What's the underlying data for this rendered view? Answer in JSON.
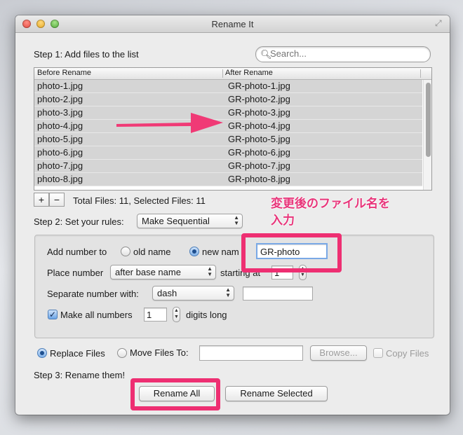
{
  "window": {
    "title": "Rename It"
  },
  "step1": {
    "label": "Step 1: Add files to the list"
  },
  "search": {
    "placeholder": "Search..."
  },
  "table": {
    "headers": [
      "Before Rename",
      "After Rename"
    ],
    "rows": [
      [
        "photo-1.jpg",
        "GR-photo-1.jpg"
      ],
      [
        "photo-2.jpg",
        "GR-photo-2.jpg"
      ],
      [
        "photo-3.jpg",
        "GR-photo-3.jpg"
      ],
      [
        "photo-4.jpg",
        "GR-photo-4.jpg"
      ],
      [
        "photo-5.jpg",
        "GR-photo-5.jpg"
      ],
      [
        "photo-6.jpg",
        "GR-photo-6.jpg"
      ],
      [
        "photo-7.jpg",
        "GR-photo-7.jpg"
      ],
      [
        "photo-8.jpg",
        "GR-photo-8.jpg"
      ]
    ]
  },
  "list_controls": {
    "add": "+",
    "remove": "−",
    "totals": "Total Files: 11,  Selected Files: 11"
  },
  "step2": {
    "label": "Step 2: Set your rules:",
    "rule": "Make Sequential"
  },
  "rules": {
    "add_number_to": "Add number to",
    "old_name": "old name",
    "new_name": "new nam",
    "new_name_value": "GR-photo",
    "place_number": "Place number",
    "place_option": "after base name",
    "starting_at": "starting at",
    "start_value": "1",
    "separate_label": "Separate number with:",
    "separator": "dash",
    "separator_field": "",
    "make_all": "Make all numbers",
    "digits_value": "1",
    "digits_long": "digits long"
  },
  "options": {
    "replace_files": "Replace Files",
    "move_files_to": "Move Files To:",
    "move_path": "",
    "browse": "Browse...",
    "copy_files": "Copy Files"
  },
  "step3": {
    "label": "Step 3: Rename them!",
    "rename_all": "Rename All",
    "rename_selected": "Rename Selected"
  },
  "annotation": {
    "line1": "変更後のファイル名を",
    "line2": "入力"
  },
  "colors": {
    "highlight": "#ee2f72",
    "selection": "#d5d5d5"
  }
}
